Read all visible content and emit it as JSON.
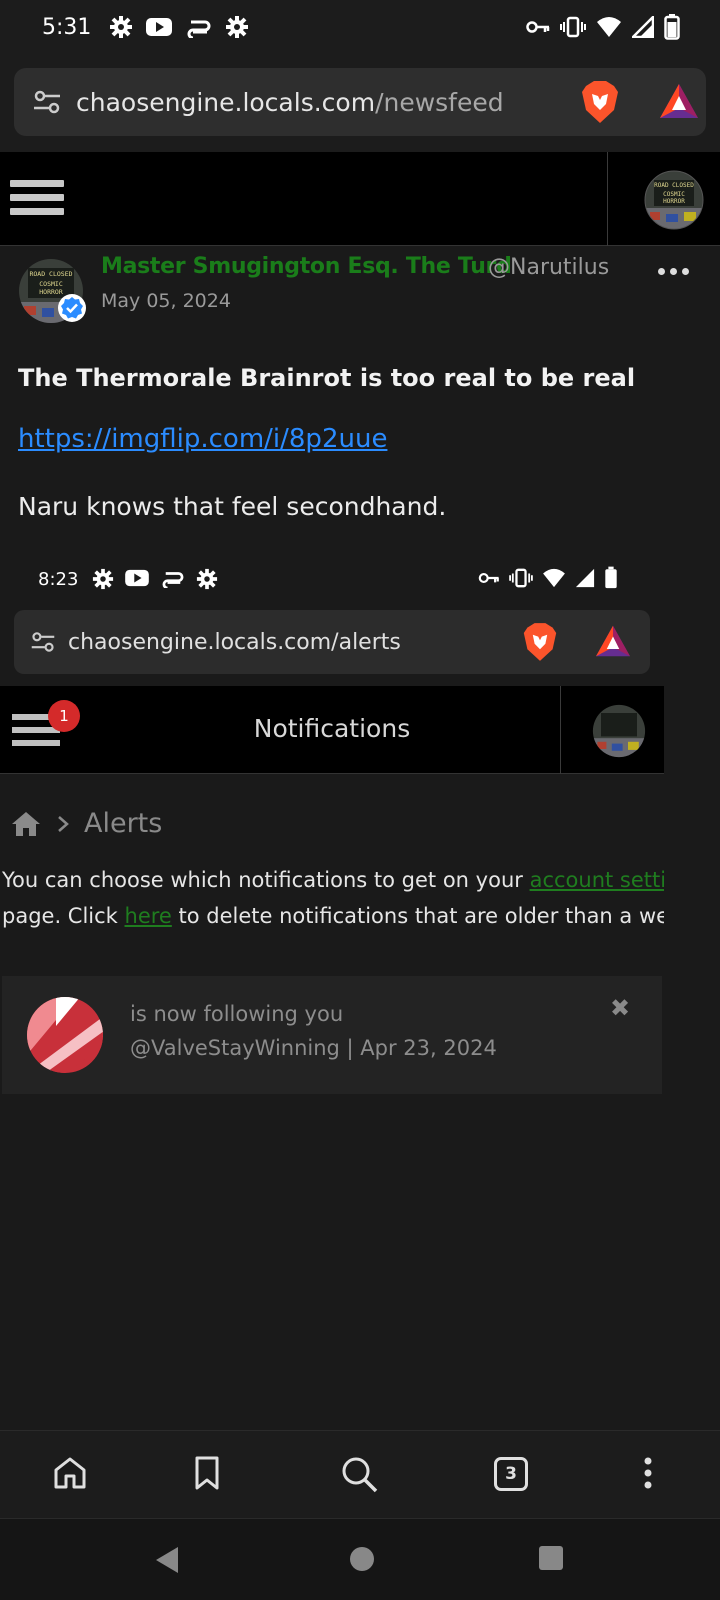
{
  "status_bar": {
    "time": "5:31",
    "left_icons": [
      "settings-icon",
      "youtube-icon",
      "infinity-icon",
      "settings-icon"
    ],
    "right_icons": [
      "key-icon",
      "vibrate-icon",
      "wifi-icon",
      "signal-icon",
      "battery-icon"
    ]
  },
  "browser": {
    "url_domain": "chaosengine.locals.com",
    "url_path": "/newsfeed",
    "tab_count": "3"
  },
  "post": {
    "author_name": "Master Smugington Esq. The Turd",
    "author_handle": "@Narutilus",
    "date": "May 05, 2024",
    "title": "The Thermorale Brainrot is too real to be real",
    "link": "https://imgflip.com/i/8p2uue",
    "body": "Naru knows that feel secondhand.",
    "avatar_text_1": "ROAD CLOSED",
    "avatar_text_2": "COSMIC",
    "avatar_text_3": "HORROR"
  },
  "embedded_screenshot": {
    "time": "8:23",
    "url": "chaosengine.locals.com/alerts",
    "notification_badge": "1",
    "header_title": "Notifications",
    "breadcrumb_current": "Alerts",
    "info_line1_pre": "You can choose which notifications to get on your ",
    "info_line1_link": "account settings",
    "info_line2_pre": "page. Click ",
    "info_line2_link": "here",
    "info_line2_post": " to delete notifications that are older than a week.",
    "notification_text": "is now following you",
    "notification_meta": "@ValveStayWinning | Apr 23, 2024"
  },
  "colors": {
    "author_green": "#1a7d1a",
    "link_blue": "#2b8cff",
    "badge_red": "#d42a2a"
  }
}
